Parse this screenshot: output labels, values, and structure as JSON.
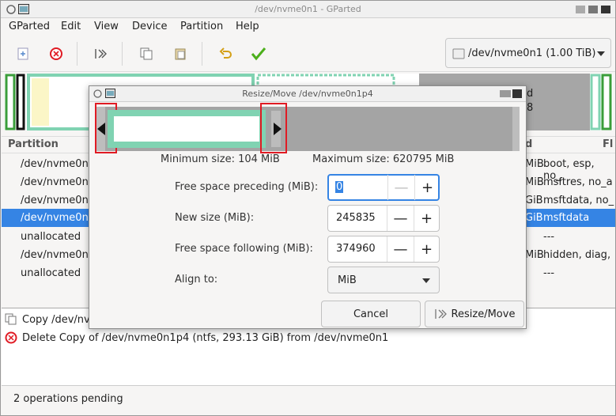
{
  "window": {
    "title": "/dev/nvme0n1 - GParted"
  },
  "menubar": [
    "GParted",
    "Edit",
    "View",
    "Device",
    "Partition",
    "Help"
  ],
  "toolbar": {
    "device_label": "/dev/nvme0n1 (1.00 TiB)"
  },
  "partition_table": {
    "columns": [
      "Partition",
      "d",
      "Fl"
    ],
    "rows": [
      {
        "partition": "/dev/nvme0n",
        "size_tail": "MiB",
        "flags": "boot, esp, no_"
      },
      {
        "partition": "/dev/nvme0n",
        "size_tail": "MiB",
        "flags": "msftres, no_a"
      },
      {
        "partition": "/dev/nvme0n",
        "size_tail": "GiB",
        "flags": "msftdata, no_"
      },
      {
        "partition": "/dev/nvme0n",
        "size_tail": "GiB",
        "flags": "msftdata",
        "selected": true
      },
      {
        "partition": "unallocated",
        "size_tail": "",
        "flags": "---"
      },
      {
        "partition": "/dev/nvme0n",
        "size_tail": "MiB",
        "flags": "hidden, diag,"
      },
      {
        "partition": "unallocated",
        "size_tail": "",
        "flags": "---"
      }
    ]
  },
  "diskmap_labels": {
    "a": "d",
    "b": "8"
  },
  "operations": [
    {
      "icon": "copy-icon",
      "text": "Copy /dev/nv"
    },
    {
      "icon": "delete-icon",
      "text": "Delete Copy of /dev/nvme0n1p4 (ntfs, 293.13 GiB) from /dev/nvme0n1"
    }
  ],
  "status": {
    "text": "2 operations pending"
  },
  "dialog": {
    "title": "Resize/Move /dev/nvme0n1p4",
    "min_size": "Minimum size: 104 MiB",
    "max_size": "Maximum size: 620795 MiB",
    "fields": [
      {
        "label": "Free space preceding (MiB):",
        "value": "0"
      },
      {
        "label": "New size (MiB):",
        "value": "245835"
      },
      {
        "label": "Free space following (MiB):",
        "value": "374960"
      }
    ],
    "align_label": "Align to:",
    "align_value": "MiB",
    "cancel": "Cancel",
    "confirm": "Resize/Move",
    "colors": {
      "partition": "#80d3b2",
      "highlight": "#e01b24"
    }
  }
}
